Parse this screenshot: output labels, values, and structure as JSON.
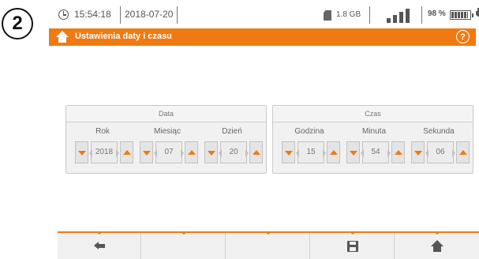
{
  "step_badge": "2",
  "status_bar": {
    "time": "15:54:18",
    "date": "2018-07-20",
    "memory": "1.8 GB",
    "battery_percent": "98 %",
    "battery_level": 0.98
  },
  "title_bar": {
    "title": "Ustawienia daty i czasu",
    "help_symbol": "?"
  },
  "date_panel": {
    "header": "Data",
    "fields": [
      {
        "label": "Rok",
        "value": "2018"
      },
      {
        "label": "Miesiąc",
        "value": "07"
      },
      {
        "label": "Dzień",
        "value": "20"
      }
    ]
  },
  "time_panel": {
    "header": "Czas",
    "fields": [
      {
        "label": "Godzina",
        "value": "15"
      },
      {
        "label": "Minuta",
        "value": "54"
      },
      {
        "label": "Sekunda",
        "value": "06"
      }
    ]
  },
  "bottom_bar": {
    "buttons": [
      "back-arrow-icon",
      "",
      "",
      "save-icon",
      "home-icon"
    ]
  },
  "colors": {
    "accent": "#f07a12",
    "panel_bg": "#f1f1f1"
  }
}
